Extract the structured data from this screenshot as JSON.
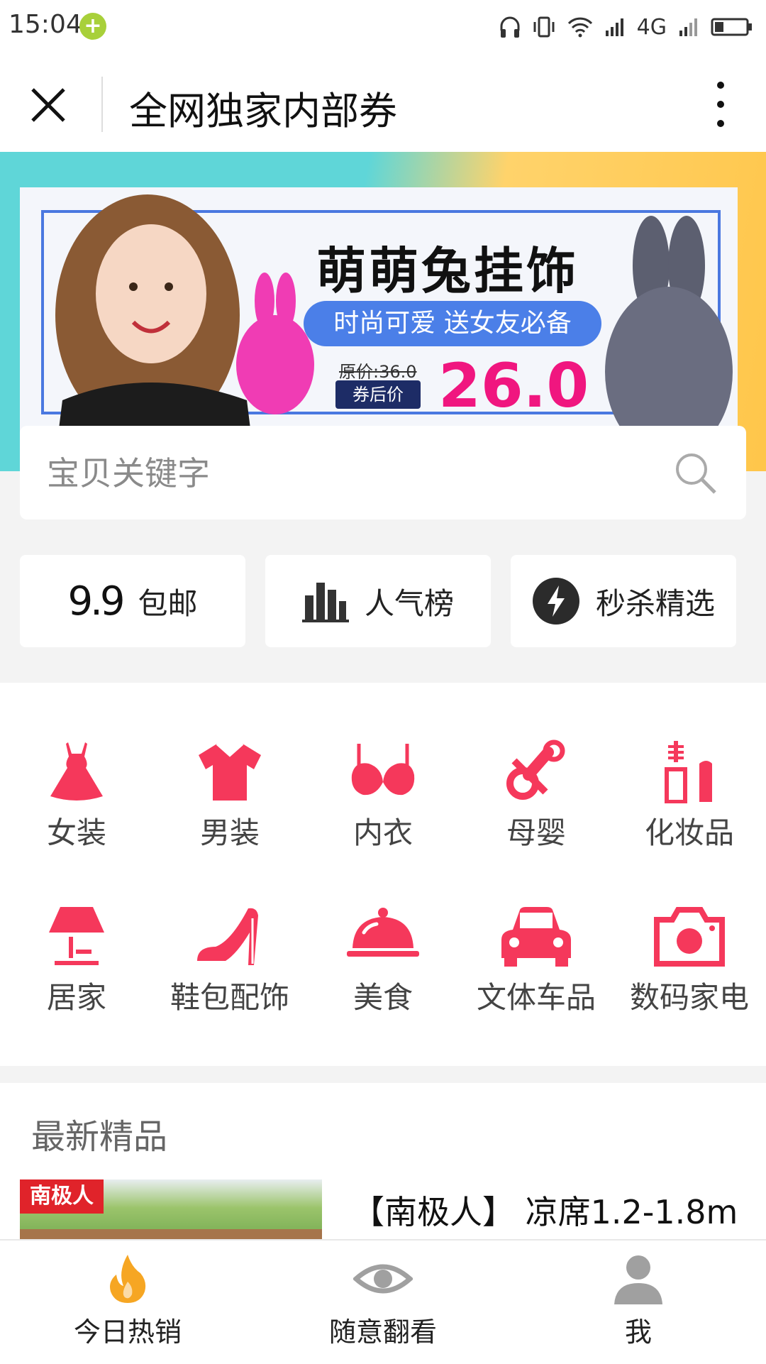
{
  "status_bar": {
    "time": "15:04",
    "network": "4G"
  },
  "title_bar": {
    "title": "全网独家内部券"
  },
  "banner": {
    "title": "萌萌兔挂饰",
    "subtitle": "时尚可爱 送女友必备",
    "original_price": "原价:36.0",
    "after_coupon_label": "券后价",
    "price": "26.0"
  },
  "search": {
    "placeholder": "宝贝关键字"
  },
  "quick_links": [
    {
      "icon_text": "9.9",
      "label": "包邮"
    },
    {
      "label": "人气榜"
    },
    {
      "label": "秒杀精选"
    }
  ],
  "categories": [
    {
      "label": "女装",
      "icon": "dress-icon"
    },
    {
      "label": "男装",
      "icon": "tshirt-icon"
    },
    {
      "label": "内衣",
      "icon": "bra-icon"
    },
    {
      "label": "母婴",
      "icon": "pacifier-icon"
    },
    {
      "label": "化妆品",
      "icon": "cosmetics-icon"
    },
    {
      "label": "居家",
      "icon": "lamp-icon"
    },
    {
      "label": "鞋包配饰",
      "icon": "high-heel-icon"
    },
    {
      "label": "美食",
      "icon": "food-cloche-icon"
    },
    {
      "label": "文体车品",
      "icon": "car-icon"
    },
    {
      "label": "数码家电",
      "icon": "camera-icon"
    }
  ],
  "latest": {
    "title": "最新精品",
    "product": {
      "brand_logo": "南极人",
      "name": "【南极人】 凉席1.2-1.8m"
    }
  },
  "bottom_nav": [
    {
      "label": "今日热销",
      "active": true
    },
    {
      "label": "随意翻看",
      "active": false
    },
    {
      "label": "我",
      "active": false
    }
  ],
  "colors": {
    "accent": "#f5385b",
    "active_nav": "#f6a623",
    "inactive_nav": "#a0a0a0",
    "banner_price": "#f0167f"
  }
}
